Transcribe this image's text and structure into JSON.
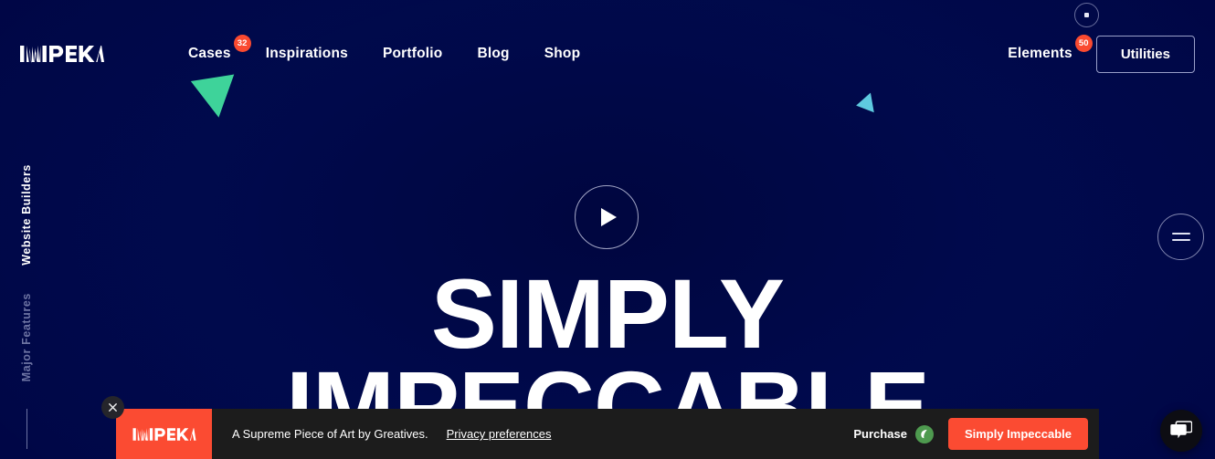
{
  "site": {
    "brand": "IMPEKA",
    "background_color": "#000449"
  },
  "header": {
    "logo_text": "IMPEKA",
    "nav": [
      {
        "label": "Cases",
        "badge": "32"
      },
      {
        "label": "Inspirations",
        "badge": ""
      },
      {
        "label": "Portfolio",
        "badge": ""
      },
      {
        "label": "Blog",
        "badge": ""
      },
      {
        "label": "Shop",
        "badge": ""
      }
    ],
    "elements_label": "Elements",
    "elements_badge": "50",
    "utilities_label": "Utilities"
  },
  "rail": {
    "active_label": "Website Builders",
    "dim_label": "Major Features"
  },
  "hero": {
    "play_icon": "play-icon",
    "headline_line1": "SIMPLY",
    "headline_line2": "IMPECCABLE"
  },
  "menu": {
    "icon": "hamburger-equals-icon"
  },
  "banner": {
    "close_icon": "close-icon",
    "logo_text": "IMPEKA",
    "message": "A Supreme Piece of Art by Greatives.",
    "privacy_link": "Privacy preferences",
    "purchase_label": "Purchase",
    "purchase_icon": "leaf-icon",
    "cta_label": "Simply Impeccable",
    "cta_color": "#fb4b32",
    "background_color": "#1c1c1c"
  },
  "chat": {
    "icon": "chat-bubbles-icon"
  },
  "decor": {
    "triangle_green_color": "#3ed39a",
    "triangle_cyan_color": "#5ecae0",
    "badge_color": "#fa4a30"
  }
}
